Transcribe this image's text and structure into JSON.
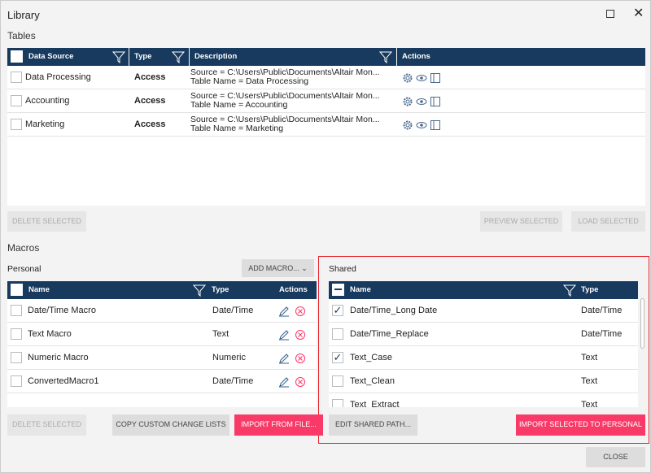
{
  "window": {
    "title": "Library"
  },
  "tables": {
    "label": "Tables",
    "columns": [
      "Data Source",
      "Type",
      "Description",
      "Actions"
    ],
    "rows": [
      {
        "name": "Data Processing",
        "type": "Access",
        "source": "Source = C:\\Users\\Public\\Documents\\Altair Mon...",
        "table": "Table Name = Data Processing"
      },
      {
        "name": "Accounting",
        "type": "Access",
        "source": "Source = C:\\Users\\Public\\Documents\\Altair Mon...",
        "table": "Table Name = Accounting"
      },
      {
        "name": "Marketing",
        "type": "Access",
        "source": "Source = C:\\Users\\Public\\Documents\\Altair Mon...",
        "table": "Table Name = Marketing"
      }
    ],
    "delete": "DELETE SELECTED",
    "preview": "PREVIEW SELECTED",
    "load": "LOAD SELECTED"
  },
  "macros": {
    "label": "Macros",
    "personal": {
      "label": "Personal",
      "add": "ADD MACRO...",
      "columns": [
        "Name",
        "Type",
        "Actions"
      ],
      "rows": [
        {
          "name": "Date/Time Macro",
          "type": "Date/Time"
        },
        {
          "name": "Text Macro",
          "type": "Text"
        },
        {
          "name": "Numeric Macro",
          "type": "Numeric"
        },
        {
          "name": "ConvertedMacro1",
          "type": "Date/Time"
        }
      ],
      "delete": "DELETE SELECTED",
      "copy": "COPY CUSTOM CHANGE LISTS",
      "import": "IMPORT FROM FILE..."
    },
    "shared": {
      "label": "Shared",
      "columns": [
        "Name",
        "Type"
      ],
      "rows": [
        {
          "name": "Date/Time_Long Date",
          "type": "Date/Time",
          "checked": true
        },
        {
          "name": "Date/Time_Replace",
          "type": "Date/Time",
          "checked": false
        },
        {
          "name": "Text_Case",
          "type": "Text",
          "checked": true
        },
        {
          "name": "Text_Clean",
          "type": "Text",
          "checked": false
        },
        {
          "name": "Text_Extract",
          "type": "Text",
          "checked": false
        }
      ],
      "edit": "EDIT SHARED PATH...",
      "import": "IMPORT SELECTED TO PERSONAL"
    }
  },
  "close": "CLOSE",
  "colors": {
    "header": "#173a5e",
    "accent": "#f93a68",
    "highlight": "#e8202a"
  }
}
